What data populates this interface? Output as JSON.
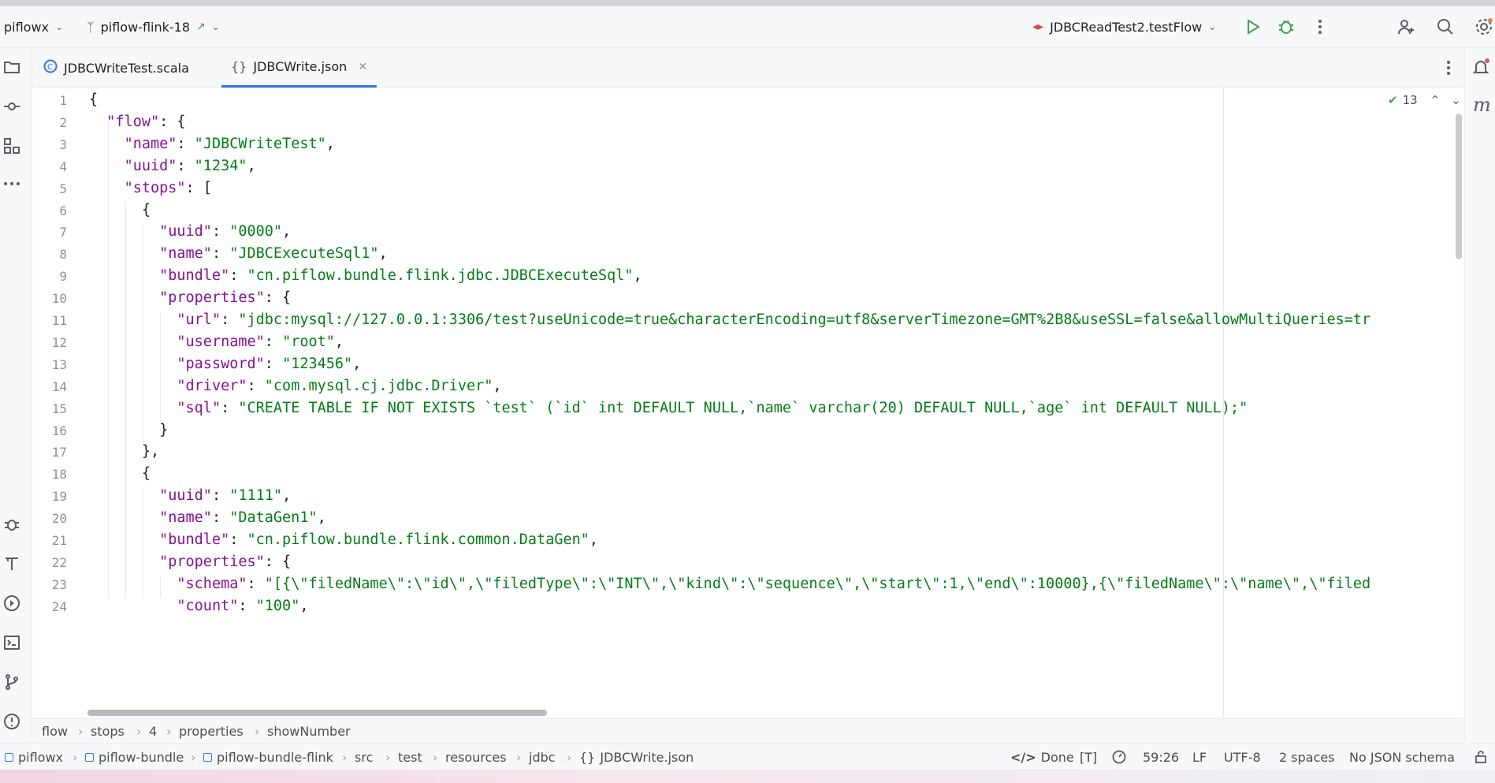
{
  "toolbar": {
    "project": "piflowx",
    "branch": "piflow-flink-18",
    "run_config": "JDBCReadTest2.testFlow"
  },
  "tabs": [
    {
      "label": "JDBCWriteTest.scala",
      "active": false
    },
    {
      "label": "JDBCWrite.json",
      "active": true
    }
  ],
  "editor": {
    "problems_count": "13",
    "line_numbers": [
      "1",
      "2",
      "3",
      "4",
      "5",
      "6",
      "7",
      "8",
      "9",
      "10",
      "11",
      "12",
      "13",
      "14",
      "15",
      "16",
      "17",
      "18",
      "19",
      "20",
      "21",
      "22",
      "23",
      "24"
    ],
    "lines": [
      "{",
      "  \"flow\": {",
      "    \"name\": \"JDBCWriteTest\",",
      "    \"uuid\": \"1234\",",
      "    \"stops\": [",
      "      {",
      "        \"uuid\": \"0000\",",
      "        \"name\": \"JDBCExecuteSql1\",",
      "        \"bundle\": \"cn.piflow.bundle.flink.jdbc.JDBCExecuteSql\",",
      "        \"properties\": {",
      "          \"url\": \"jdbc:mysql://127.0.0.1:3306/test?useUnicode=true&characterEncoding=utf8&serverTimezone=GMT%2B8&useSSL=false&allowMultiQueries=tr",
      "          \"username\": \"root\",",
      "          \"password\": \"123456\",",
      "          \"driver\": \"com.mysql.cj.jdbc.Driver\",",
      "          \"sql\": \"CREATE TABLE IF NOT EXISTS `test` (`id` int DEFAULT NULL,`name` varchar(20) DEFAULT NULL,`age` int DEFAULT NULL);\"",
      "        }",
      "      },",
      "      {",
      "        \"uuid\": \"1111\",",
      "        \"name\": \"DataGen1\",",
      "        \"bundle\": \"cn.piflow.bundle.flink.common.DataGen\",",
      "        \"properties\": {",
      "          \"schema\": \"[{\\\"filedName\\\":\\\"id\\\",\\\"filedType\\\":\\\"INT\\\",\\\"kind\\\":\\\"sequence\\\",\\\"start\\\":1,\\\"end\\\":10000},{\\\"filedName\\\":\\\"name\\\",\\\"filed",
      "          \"count\": \"100\","
    ]
  },
  "breadcrumbs": [
    "flow",
    "stops",
    "4",
    "properties",
    "showNumber"
  ],
  "statusbar": {
    "path": [
      "piflowx",
      "piflow-bundle",
      "piflow-bundle-flink",
      "src",
      "test",
      "resources",
      "jdbc",
      "JDBCWrite.json"
    ],
    "done": "Done",
    "t_label": "[T]",
    "position": "59:26",
    "line_sep": "LF",
    "encoding": "UTF-8",
    "indent": "2 spaces",
    "schema": "No JSON schema"
  },
  "colors": {
    "key": "#871094",
    "string": "#067d17",
    "accent": "#3574f0",
    "run": "#499c54"
  }
}
